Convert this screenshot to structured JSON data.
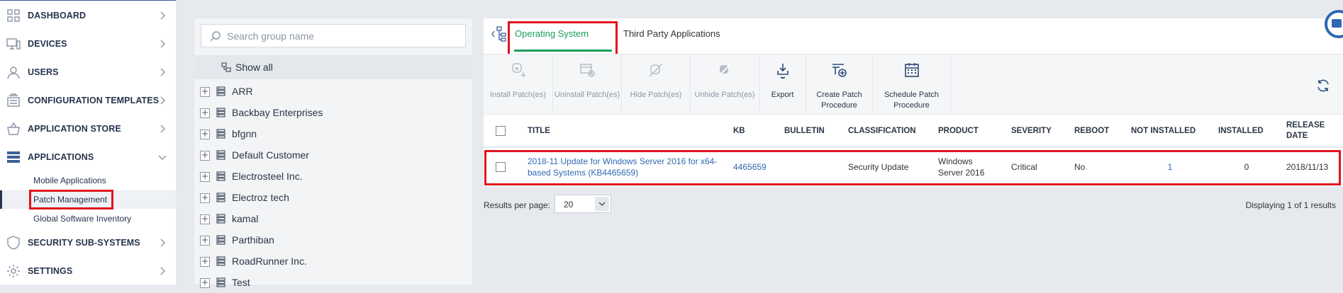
{
  "sidebar": {
    "items": [
      {
        "label": "DASHBOARD",
        "icon": "dashboard-grid-icon"
      },
      {
        "label": "DEVICES",
        "icon": "devices-icon"
      },
      {
        "label": "USERS",
        "icon": "user-icon"
      },
      {
        "label": "CONFIGURATION TEMPLATES",
        "icon": "templates-icon"
      },
      {
        "label": "APPLICATION STORE",
        "icon": "store-basket-icon"
      },
      {
        "label": "APPLICATIONS",
        "icon": "applications-icon"
      },
      {
        "label": "SECURITY SUB-SYSTEMS",
        "icon": "shield-icon"
      },
      {
        "label": "SETTINGS",
        "icon": "gear-icon"
      }
    ],
    "subitems": [
      "Mobile Applications",
      "Patch Management",
      "Global Software Inventory"
    ],
    "active_subitem": "Patch Management",
    "accent_color": "#26344d"
  },
  "groups": {
    "search_placeholder": "Search group name",
    "show_all": "Show all",
    "list": [
      "ARR",
      "Backbay Enterprises",
      "bfgnn",
      "Default Customer",
      "Electrosteel Inc.",
      "Electroz tech",
      "kamal",
      "Parthiban",
      "RoadRunner Inc.",
      "Test"
    ]
  },
  "tabs": {
    "os": "Operating System",
    "third": "Third Party Applications",
    "active": "Operating System",
    "active_color": "#1a9e5b"
  },
  "toolbar": {
    "install": "Install Patch(es)",
    "uninstall": "Uninstall Patch(es)",
    "hide": "Hide Patch(es)",
    "unhide": "Unhide Patch(es)",
    "export": "Export",
    "create": "Create Patch Procedure",
    "schedule": "Schedule Patch Procedure"
  },
  "table": {
    "headers": {
      "title": "TITLE",
      "kb": "KB",
      "bulletin": "BULLETIN",
      "classification": "CLASSIFICATION",
      "product": "PRODUCT",
      "severity": "SEVERITY",
      "reboot": "REBOOT",
      "not_installed": "NOT INSTALLED",
      "installed": "INSTALLED",
      "release_date": "RELEASE DATE"
    },
    "rows": [
      {
        "title": "2018-11 Update for Windows Server 2016 for x64-based Systems (KB4465659)",
        "kb": "4465659",
        "bulletin": "",
        "classification": "Security Update",
        "product": "Windows Server 2016",
        "severity": "Critical",
        "reboot": "No",
        "not_installed": "1",
        "installed": "0",
        "release_date": "2018/11/13"
      }
    ]
  },
  "footer": {
    "results_label": "Results per page:",
    "results_value": "20",
    "displaying": "Displaying 1 of 1 results"
  },
  "highlight_color": "#e0141e",
  "link_color": "#2f68b3"
}
